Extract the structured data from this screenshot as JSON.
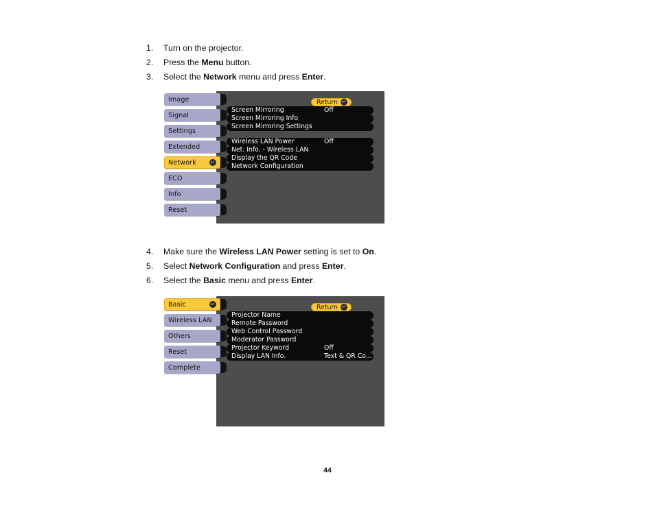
{
  "document": {
    "page_number": "44"
  },
  "instructions_top": [
    {
      "num": "1.",
      "parts": [
        {
          "t": "Turn on the projector.",
          "b": false
        }
      ]
    },
    {
      "num": "2.",
      "parts": [
        {
          "t": "Press the ",
          "b": false
        },
        {
          "t": "Menu",
          "b": true
        },
        {
          "t": " button.",
          "b": false
        }
      ]
    },
    {
      "num": "3.",
      "parts": [
        {
          "t": "Select the ",
          "b": false
        },
        {
          "t": "Network",
          "b": true
        },
        {
          "t": " menu and press ",
          "b": false
        },
        {
          "t": "Enter",
          "b": true
        },
        {
          "t": ".",
          "b": false
        }
      ]
    }
  ],
  "instructions_mid": [
    {
      "num": "4.",
      "parts": [
        {
          "t": "Make sure the ",
          "b": false
        },
        {
          "t": "Wireless LAN Power",
          "b": true
        },
        {
          "t": " setting is set to ",
          "b": false
        },
        {
          "t": "On",
          "b": true
        },
        {
          "t": ".",
          "b": false
        }
      ]
    },
    {
      "num": "5.",
      "parts": [
        {
          "t": "Select ",
          "b": false
        },
        {
          "t": "Network Configuration",
          "b": true
        },
        {
          "t": " and press ",
          "b": false
        },
        {
          "t": "Enter",
          "b": true
        },
        {
          "t": ".",
          "b": false
        }
      ]
    },
    {
      "num": "6.",
      "parts": [
        {
          "t": "Select the ",
          "b": false
        },
        {
          "t": "Basic",
          "b": true
        },
        {
          "t": " menu and press ",
          "b": false
        },
        {
          "t": "Enter",
          "b": true
        },
        {
          "t": ".",
          "b": false
        }
      ]
    }
  ],
  "osd_network": {
    "return_label": "Return",
    "enter_glyph": "↵",
    "sidebar": [
      {
        "label": "Image",
        "active": false
      },
      {
        "label": "Signal",
        "active": false
      },
      {
        "label": "Settings",
        "active": false
      },
      {
        "label": "Extended",
        "active": false
      },
      {
        "label": "Network",
        "active": true
      },
      {
        "label": "ECO",
        "active": false
      },
      {
        "label": "Info",
        "active": false
      },
      {
        "label": "Reset",
        "active": false
      }
    ],
    "groups": [
      {
        "rows": [
          {
            "label": "Screen Mirroring",
            "value": "Off"
          },
          {
            "label": "Screen Mirroring Info",
            "value": ""
          },
          {
            "label": "Screen Mirroring Settings",
            "value": ""
          }
        ]
      },
      {
        "rows": [
          {
            "label": "Wireless LAN Power",
            "value": "Off"
          },
          {
            "label": "Net. Info. - Wireless LAN",
            "value": ""
          },
          {
            "label": "Display the QR Code",
            "value": ""
          },
          {
            "label": "Network Configuration",
            "value": ""
          }
        ]
      }
    ]
  },
  "osd_basic": {
    "return_label": "Return",
    "enter_glyph": "↵",
    "sidebar": [
      {
        "label": "Basic",
        "active": true
      },
      {
        "label": "Wireless LAN",
        "active": false
      },
      {
        "label": "Others",
        "active": false
      },
      {
        "label": "Reset",
        "active": false
      },
      {
        "label": "Complete",
        "active": false
      }
    ],
    "groups": [
      {
        "rows": [
          {
            "label": "Projector Name",
            "value": ""
          },
          {
            "label": "Remote Password",
            "value": ""
          },
          {
            "label": "Web Control Password",
            "value": ""
          },
          {
            "label": "Moderator Password",
            "value": ""
          },
          {
            "label": "Projector Keyword",
            "value": "Off"
          },
          {
            "label": "Display LAN Info.",
            "value": "Text & QR Co..."
          }
        ]
      }
    ]
  },
  "colors": {
    "osd_background": "#4d4d4d",
    "sidebar_tab": "#a7a7c9",
    "highlight": "#fbc93d",
    "row_background": "#0b0b0b"
  }
}
